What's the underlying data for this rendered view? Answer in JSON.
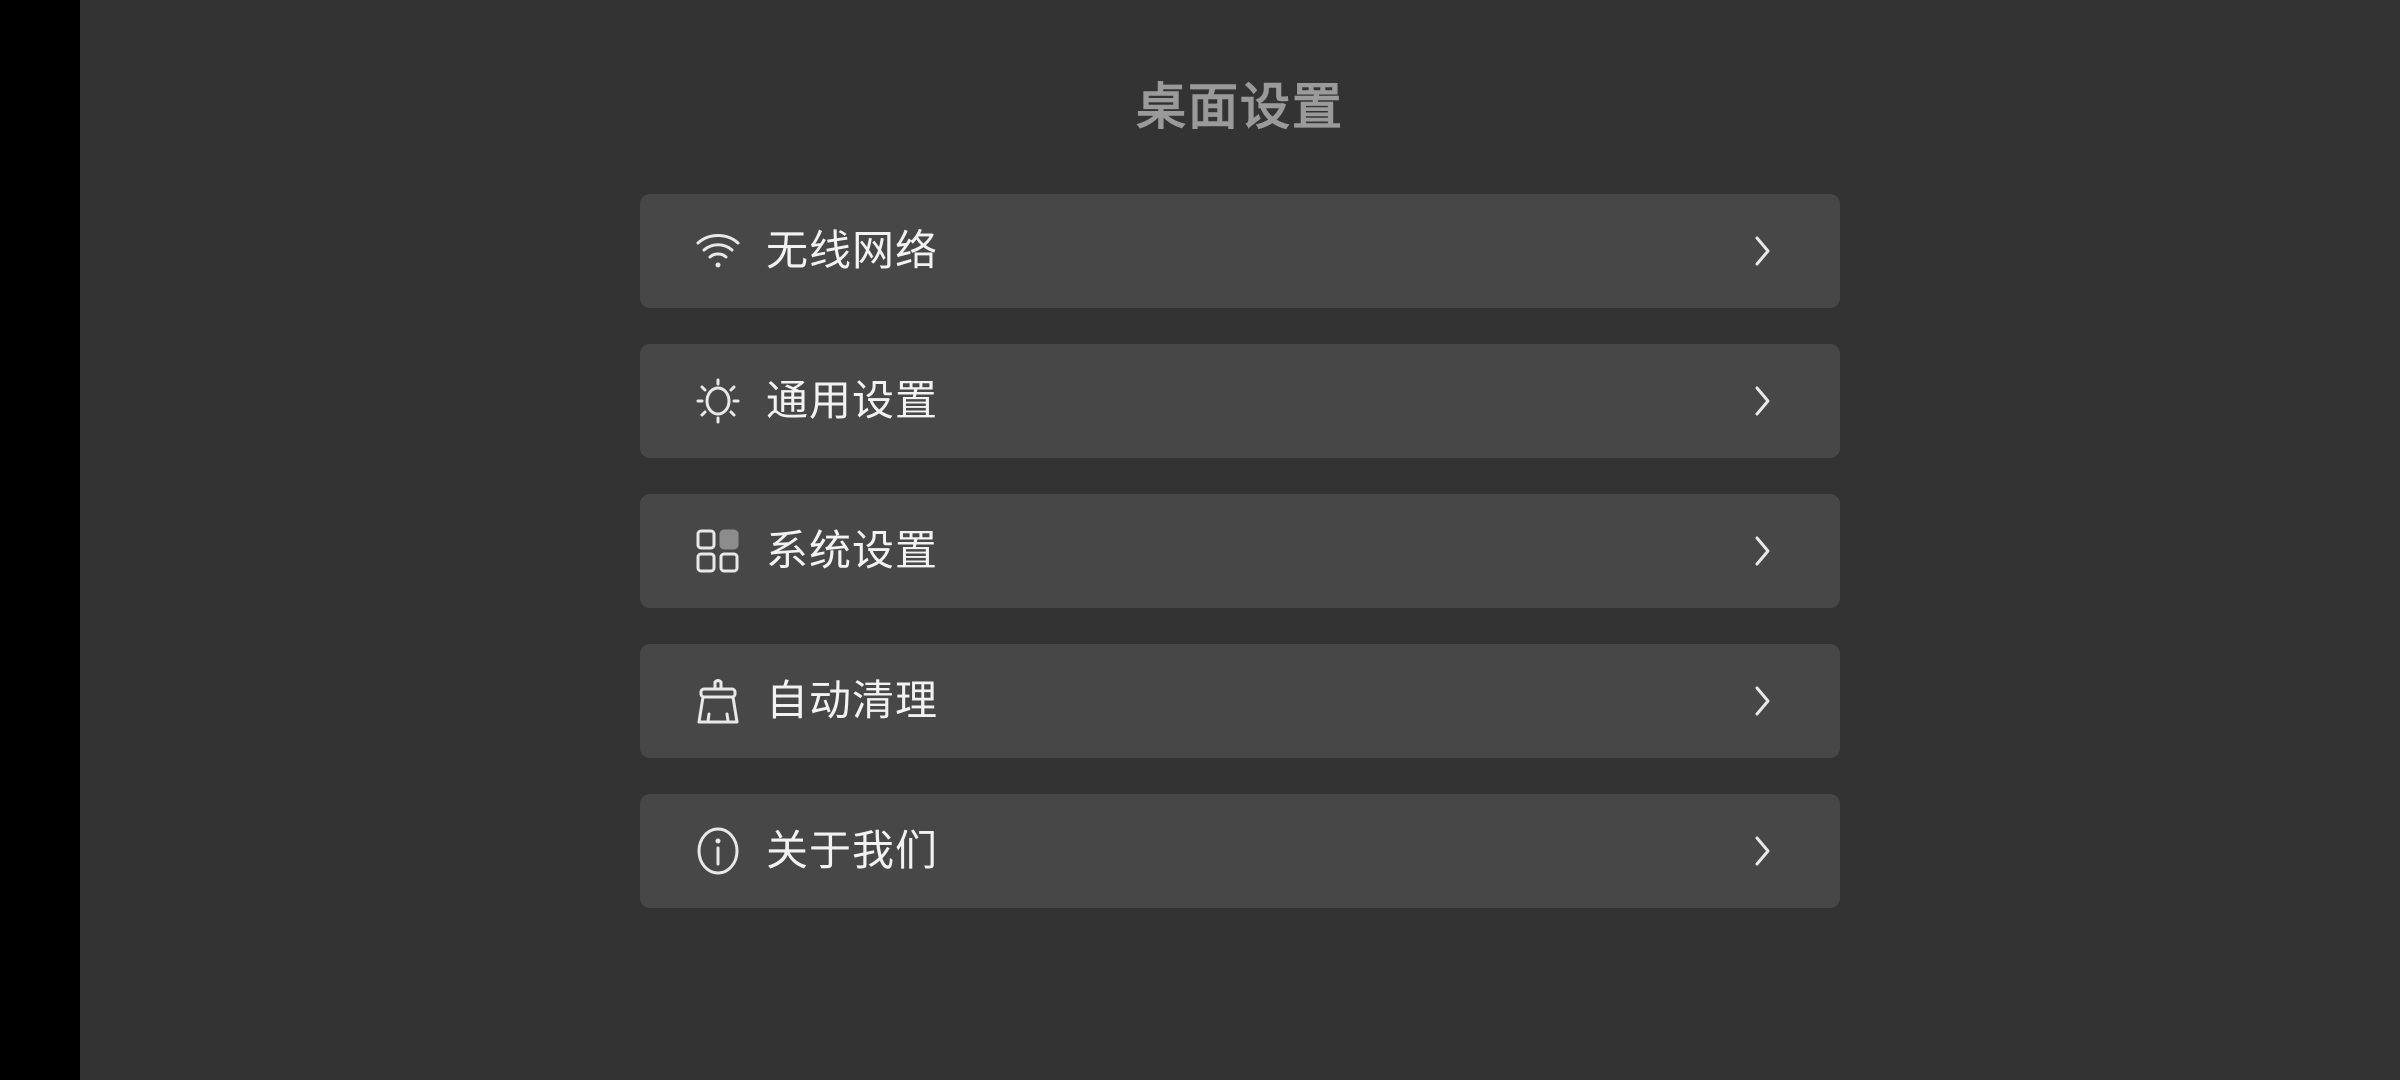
{
  "page": {
    "title": "桌面设置"
  },
  "colors": {
    "background": "#333333",
    "card": "#474747",
    "title": "#9a9a9a",
    "text": "#f2f2f2",
    "left_strip": "#000000"
  },
  "menu": {
    "items": [
      {
        "label": "无线网络",
        "icon": "wifi-icon"
      },
      {
        "label": "通用设置",
        "icon": "sun-gear-icon"
      },
      {
        "label": "系统设置",
        "icon": "grid-apps-icon"
      },
      {
        "label": "自动清理",
        "icon": "broom-icon"
      },
      {
        "label": "关于我们",
        "icon": "info-icon"
      }
    ]
  }
}
